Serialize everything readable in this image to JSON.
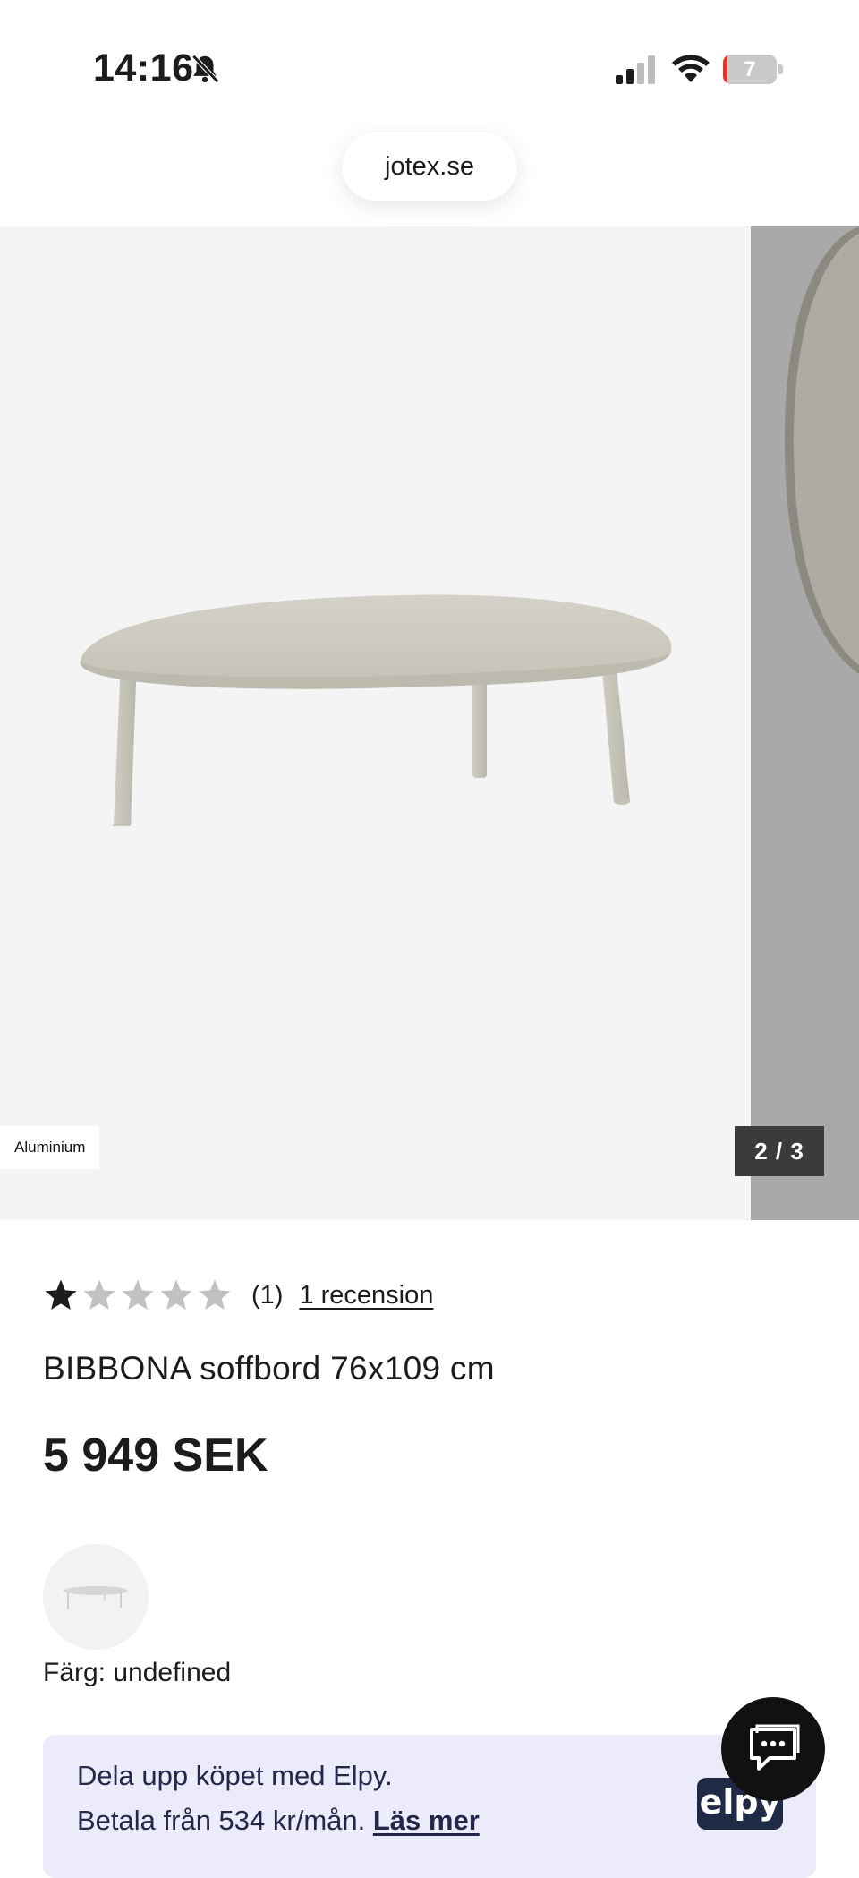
{
  "status_bar": {
    "time": "14:16",
    "battery_percent": "7",
    "battery_level": 0.07,
    "icons": [
      "bell-slash-icon",
      "cellular-signal-icon",
      "wifi-icon",
      "battery-icon"
    ]
  },
  "browser": {
    "url": "jotex.se"
  },
  "gallery": {
    "material_badge": "Aluminium",
    "counter": "2 / 3",
    "image_subject": "oval coffee table"
  },
  "product": {
    "rating": {
      "stars_filled": 1,
      "stars_total": 5,
      "count": "(1)",
      "review_link": "1 recension"
    },
    "title": "BIBBONA soffbord 76x109 cm",
    "price": "5 949 SEK",
    "color_label": "Färg: undefined"
  },
  "elpy": {
    "line1": "Dela upp köpet med Elpy.",
    "line2_prefix": "Betala från 534 kr/mån.",
    "read_more": "Läs mer",
    "logo_text": "elpy"
  },
  "chat": {
    "icon": "chat-bubble-icon"
  },
  "colors": {
    "star_filled": "#1c1c1c",
    "star_empty": "#c2c2c2",
    "elpy_background": "#ecebf9",
    "elpy_logo": "#1f2a44",
    "counter_bg": "#3b3b3b",
    "battery_low": "#e5322d"
  }
}
